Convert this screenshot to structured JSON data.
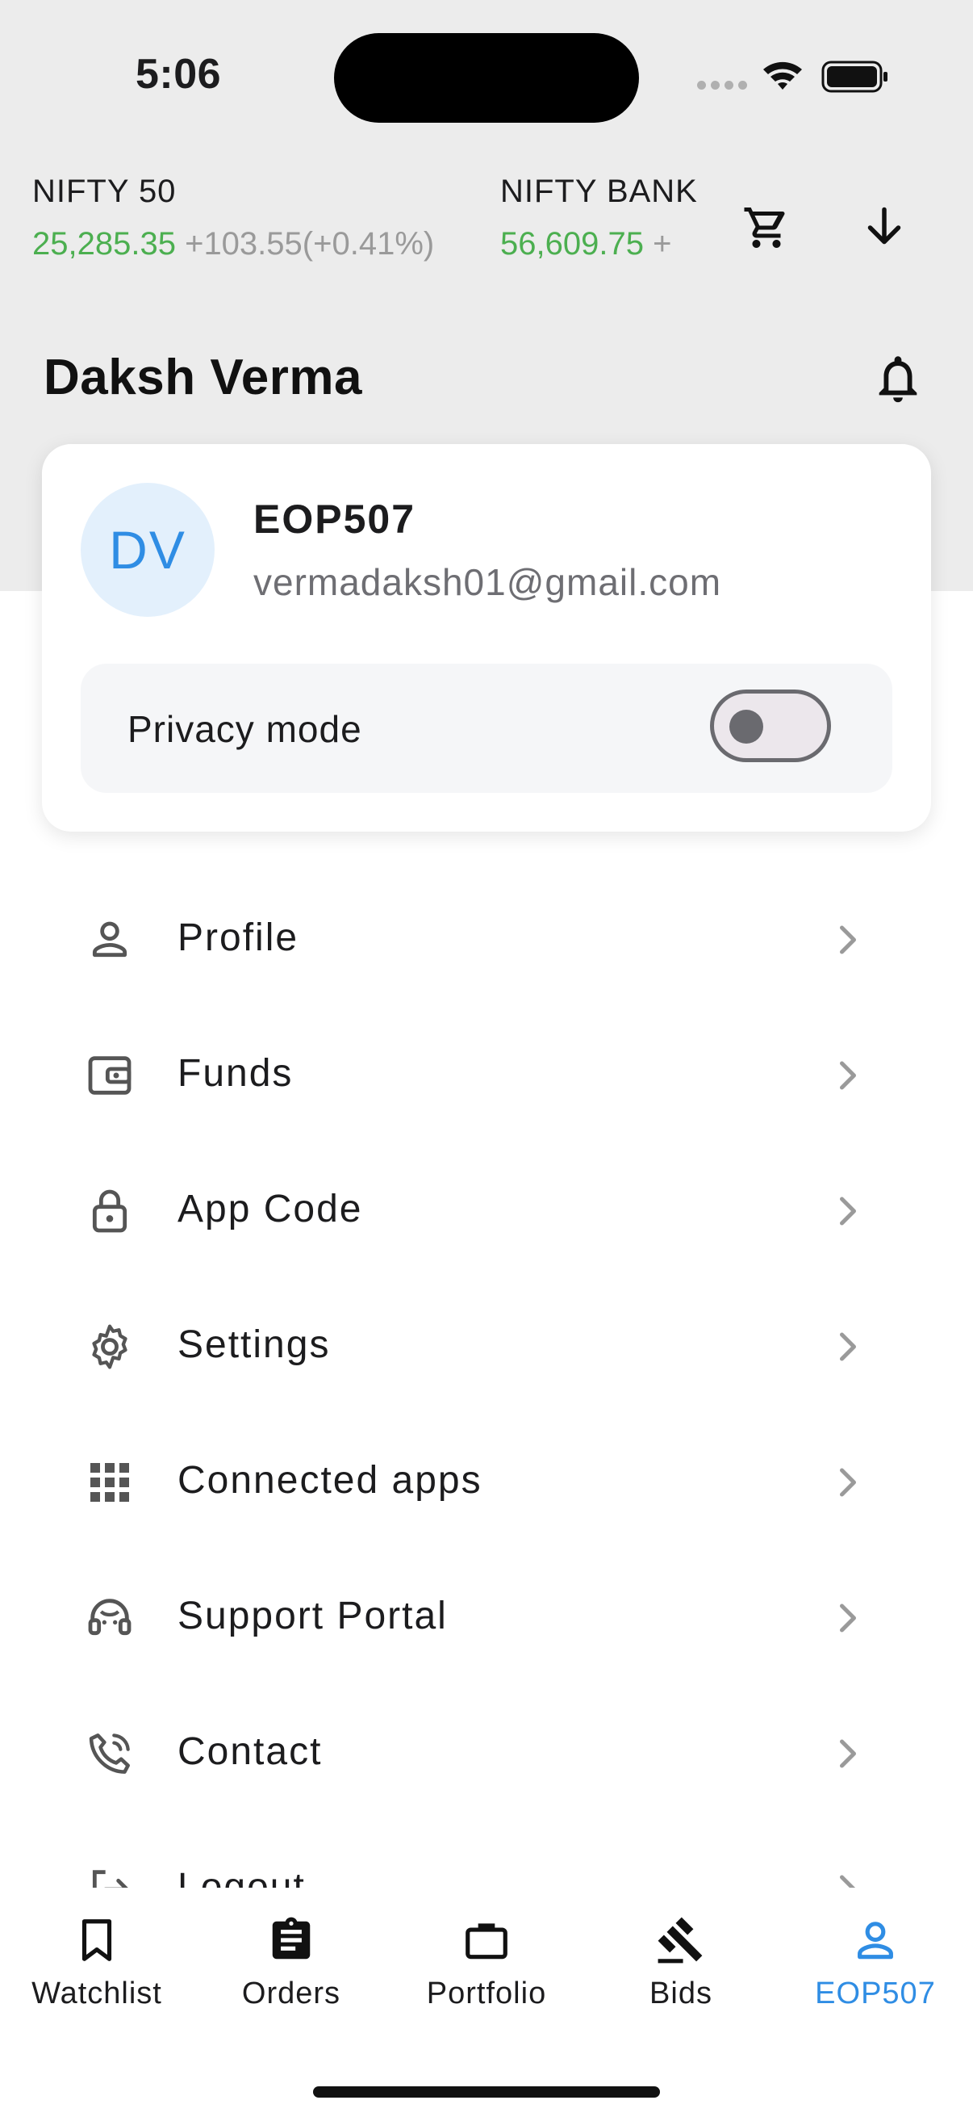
{
  "status_bar": {
    "time": "5:06"
  },
  "ticker": [
    {
      "name": "NIFTY 50",
      "value": "25,285.35",
      "change": "+103.55(+0.41%)"
    },
    {
      "name": "NIFTY BANK",
      "value": "56,609.75",
      "change": "+"
    }
  ],
  "header": {
    "user_name": "Daksh Verma"
  },
  "profile_card": {
    "initials": "DV",
    "client_id": "EOP507",
    "email": "vermadaksh01@gmail.com",
    "privacy_label": "Privacy mode",
    "privacy_enabled": false
  },
  "menu": {
    "items": [
      {
        "label": "Profile",
        "icon": "person-icon"
      },
      {
        "label": "Funds",
        "icon": "wallet-icon"
      },
      {
        "label": "App Code",
        "icon": "lock-icon"
      },
      {
        "label": "Settings",
        "icon": "gear-icon"
      },
      {
        "label": "Connected apps",
        "icon": "grid-icon"
      },
      {
        "label": "Support Portal",
        "icon": "support-icon"
      },
      {
        "label": "Contact",
        "icon": "phone-icon"
      },
      {
        "label": "Logout",
        "icon": "logout-icon"
      }
    ]
  },
  "bottom_nav": {
    "items": [
      {
        "label": "Watchlist",
        "icon": "bookmark-icon"
      },
      {
        "label": "Orders",
        "icon": "clipboard-icon"
      },
      {
        "label": "Portfolio",
        "icon": "briefcase-icon"
      },
      {
        "label": "Bids",
        "icon": "gavel-icon"
      },
      {
        "label": "EOP507",
        "icon": "person-icon",
        "active": true
      }
    ]
  },
  "colors": {
    "accent": "#2f8de4",
    "positive": "#4caf50",
    "muted": "#9a9a9a"
  }
}
